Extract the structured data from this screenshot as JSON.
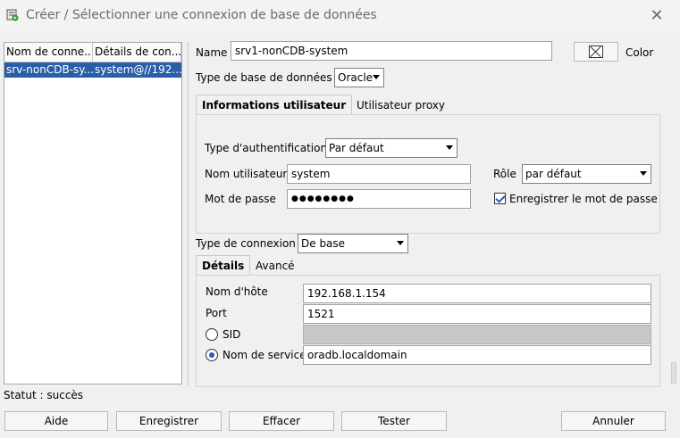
{
  "window": {
    "title": "Créer / Sélectionner une connexion de base de données",
    "close_glyph": "✕",
    "icon": "database-connection-icon"
  },
  "connections": {
    "columns": [
      "Nom de conne...",
      "Détails de con..."
    ],
    "rows": [
      {
        "name": "srv-nonCDB-sy...",
        "details": "system@//192...",
        "selected": true
      }
    ]
  },
  "form": {
    "name_label": "Name",
    "name_value": "srv1-nonCDB-system",
    "color_label": "Color",
    "db_type_label": "Type de base de données",
    "db_type_value": "Oracle",
    "tabs": [
      "Informations utilisateur",
      "Utilisateur proxy"
    ],
    "auth_type_label": "Type d'authentification",
    "auth_type_value": "Par défaut",
    "username_label": "Nom utilisateur",
    "username_value": "system",
    "role_label": "Rôle",
    "role_value": "par défaut",
    "password_label": "Mot de passe",
    "password_value": "●●●●●●●●",
    "save_password_label": "Enregistrer le mot de passe",
    "save_password_checked": true,
    "conn_type_label": "Type de connexion",
    "conn_type_value": "De base",
    "detail_tabs": [
      "Détails",
      "Avancé"
    ],
    "host_label": "Nom d'hôte",
    "host_value": "192.168.1.154",
    "port_label": "Port",
    "port_value": "1521",
    "sid_label": "SID",
    "sid_value": "",
    "service_label": "Nom de service",
    "service_value": "oradb.localdomain",
    "service_selected": true
  },
  "status": "Statut : succès",
  "buttons": {
    "help": "Aide",
    "save": "Enregistrer",
    "clear": "Effacer",
    "test": "Tester",
    "cancel": "Annuler"
  }
}
